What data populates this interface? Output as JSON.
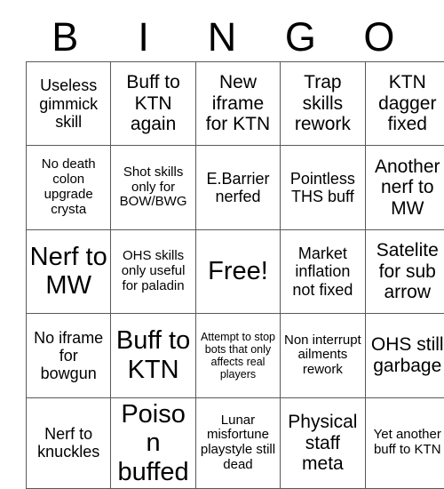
{
  "card": {
    "title_letters": [
      "B",
      "I",
      "N",
      "G",
      "O"
    ],
    "rows": [
      [
        {
          "text": "Useless gimmick skill",
          "size": "md"
        },
        {
          "text": "Buff to KTN again",
          "size": "lg"
        },
        {
          "text": "New iframe for KTN",
          "size": "lg"
        },
        {
          "text": "Trap skills rework",
          "size": "lg"
        },
        {
          "text": "KTN dagger fixed",
          "size": "lg"
        }
      ],
      [
        {
          "text": "No death colon upgrade crysta",
          "size": "sm"
        },
        {
          "text": "Shot skills only for BOW/BWG",
          "size": "sm"
        },
        {
          "text": "E.Barrier nerfed",
          "size": "md"
        },
        {
          "text": "Pointless THS buff",
          "size": "md"
        },
        {
          "text": "Another nerf to MW",
          "size": "lg"
        }
      ],
      [
        {
          "text": "Nerf to MW",
          "size": "xl"
        },
        {
          "text": "OHS skills only useful for paladin",
          "size": "sm"
        },
        {
          "text": "Free!",
          "size": "xl"
        },
        {
          "text": "Market inflation not fixed",
          "size": "md"
        },
        {
          "text": "Satelite for sub arrow",
          "size": "lg"
        }
      ],
      [
        {
          "text": "No iframe for bowgun",
          "size": "md"
        },
        {
          "text": "Buff to KTN",
          "size": "xl"
        },
        {
          "text": "Attempt to stop bots that only affects real players",
          "size": "xs"
        },
        {
          "text": "Non interrupt ailments rework",
          "size": "sm"
        },
        {
          "text": "OHS still garbage",
          "size": "lg"
        }
      ],
      [
        {
          "text": "Nerf to knuckles",
          "size": "md"
        },
        {
          "text": "Poison buffed",
          "size": "xl"
        },
        {
          "text": "Lunar misfortune playstyle still dead",
          "size": "sm"
        },
        {
          "text": "Physical staff meta",
          "size": "lg"
        },
        {
          "text": "Yet another buff to KTN",
          "size": "sm"
        }
      ]
    ]
  },
  "colors": {
    "background": "#ffffff",
    "text": "#000000",
    "grid_line": "#595959"
  }
}
